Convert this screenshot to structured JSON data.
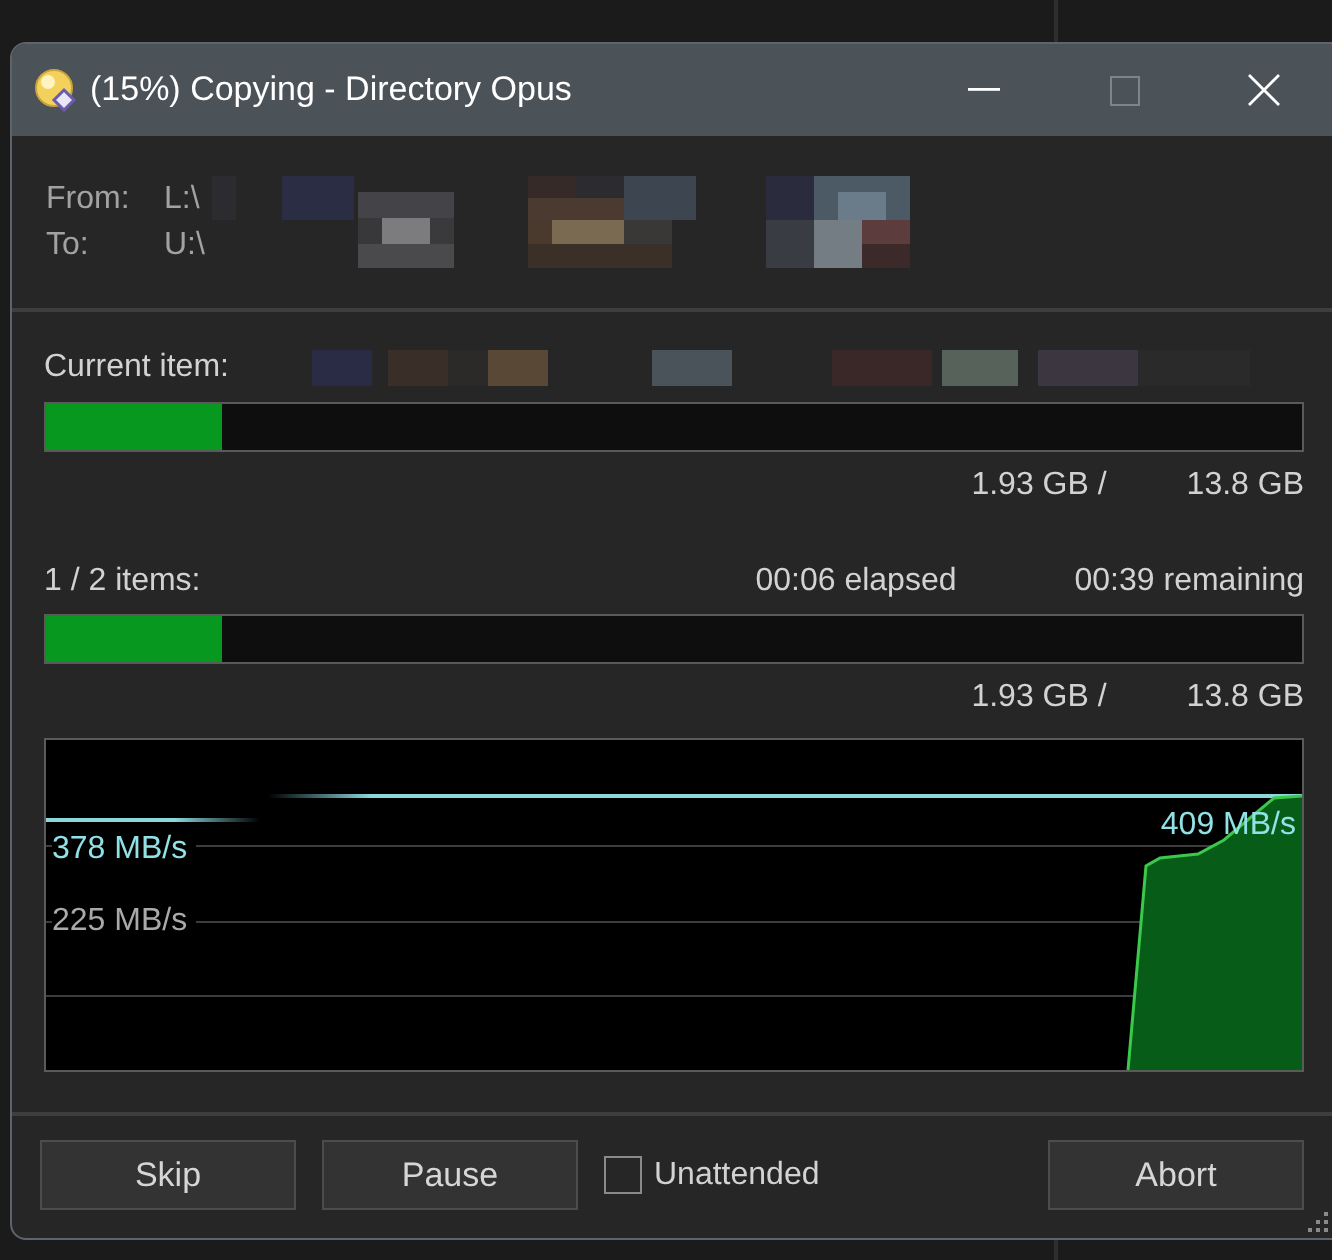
{
  "window": {
    "title": "(15%) Copying - Directory Opus",
    "controls": [
      {
        "kind": "minimize",
        "disabled": false
      },
      {
        "kind": "maximize",
        "disabled": true
      },
      {
        "kind": "close",
        "disabled": false
      }
    ]
  },
  "paths": [
    {
      "label": "From:",
      "value": "L:\\"
    },
    {
      "label": "To:",
      "value": "U:\\"
    }
  ],
  "current_item": {
    "label": "Current item:",
    "level": 0.14,
    "done": "1.93 GB /",
    "total": "13.8 GB"
  },
  "overall": {
    "label": "1 / 2 items:",
    "elapsed": "00:06 elapsed",
    "remaining": "00:39 remaining",
    "level": 0.14,
    "done": "1.93 GB /",
    "total": "13.8 GB"
  },
  "speed_graph": {
    "average": "378 MB/s",
    "gridline": "225 MB/s",
    "current": "409 MB/s"
  },
  "footer": {
    "buttons": [
      {
        "label": "Skip"
      },
      {
        "label": "Pause"
      }
    ],
    "checkbox": {
      "label": "Unattended",
      "checked": false
    },
    "abort": {
      "label": "Abort"
    }
  }
}
